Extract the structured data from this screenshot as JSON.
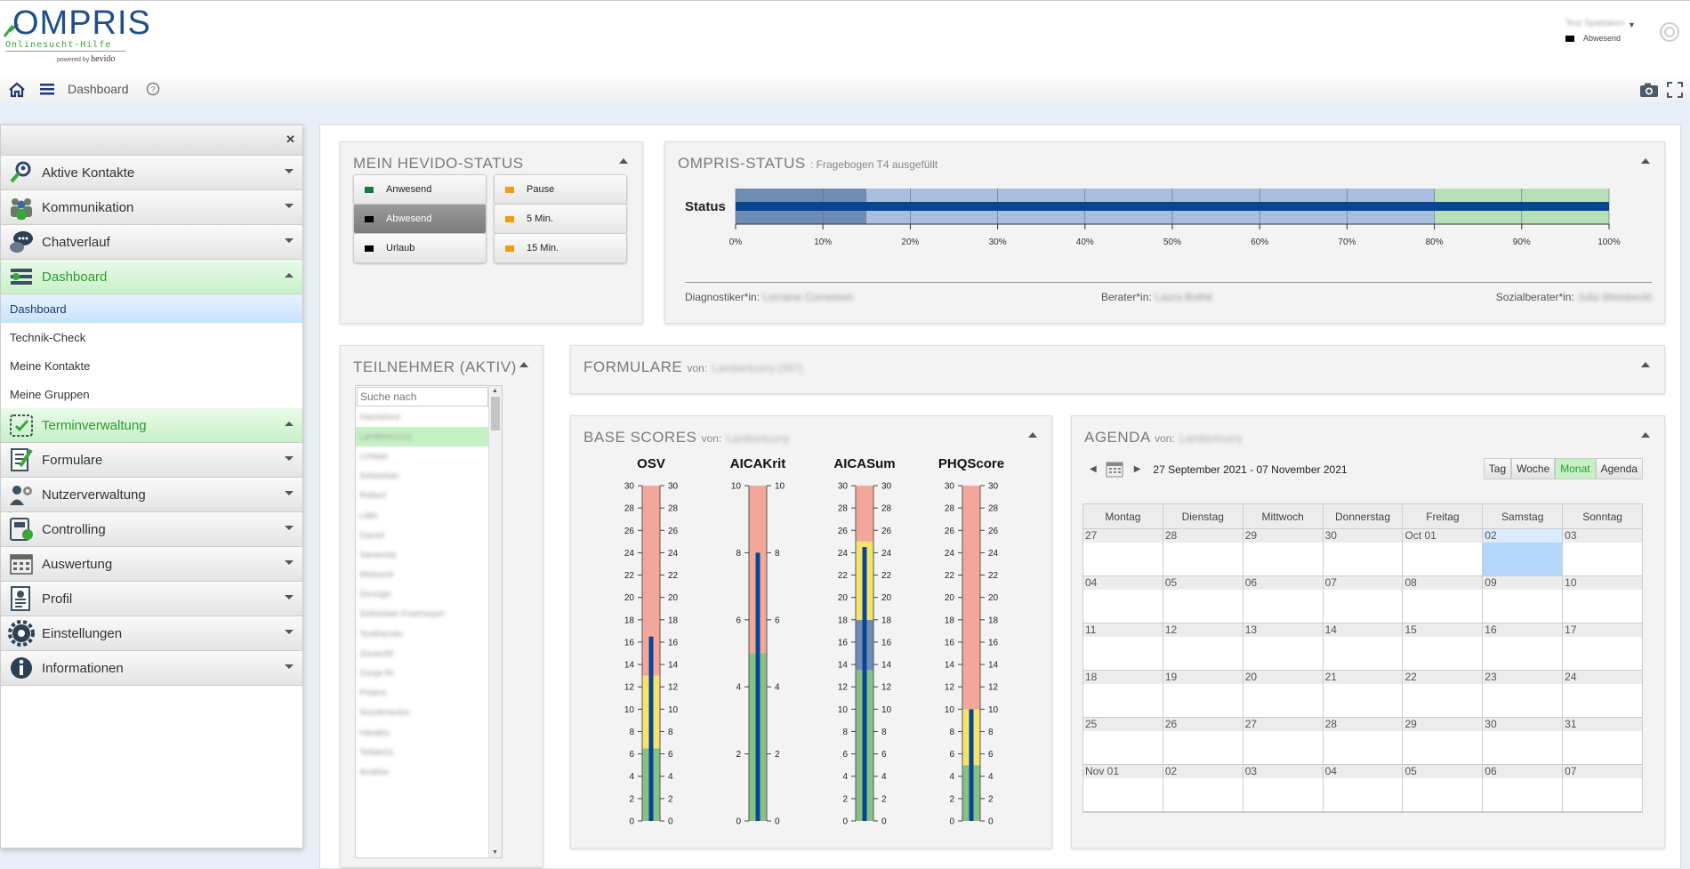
{
  "logo": {
    "main": "OMPRIS",
    "sub": "Onlinesucht-Hilfe",
    "powered": "powered by",
    "brand": "hevido"
  },
  "user": {
    "name": "Test Spattaken",
    "status": "Abwesend",
    "status_color": "#000000"
  },
  "nav": {
    "page": "Dashboard"
  },
  "sidebar": {
    "items": [
      {
        "label": "Aktive Kontakte",
        "icon": "search-person-icon"
      },
      {
        "label": "Kommunikation",
        "icon": "people-icon"
      },
      {
        "label": "Chatverlauf",
        "icon": "chat-icon"
      },
      {
        "label": "Dashboard",
        "icon": "dashboard-icon",
        "active": true
      },
      {
        "label": "Terminverwaltung",
        "icon": "calendar-check-icon",
        "active": true
      },
      {
        "label": "Formulare",
        "icon": "form-edit-icon"
      },
      {
        "label": "Nutzerverwaltung",
        "icon": "user-gear-icon"
      },
      {
        "label": "Controlling",
        "icon": "controlling-icon"
      },
      {
        "label": "Auswertung",
        "icon": "calendar-grid-icon"
      },
      {
        "label": "Profil",
        "icon": "profile-card-icon"
      },
      {
        "label": "Einstellungen",
        "icon": "gear-icon"
      },
      {
        "label": "Informationen",
        "icon": "info-icon"
      }
    ],
    "dashboard_sub": [
      "Dashboard",
      "Technik-Check",
      "Meine Kontakte",
      "Meine Gruppen"
    ]
  },
  "hevido_status": {
    "title": "MEIN HEVIDO-STATUS",
    "buttons": [
      {
        "label": "Anwesend",
        "color": "#1a7a3a"
      },
      {
        "label": "Pause",
        "color": "#f39c12"
      },
      {
        "label": "Abwesend",
        "color": "#000000",
        "selected": true
      },
      {
        "label": "5 Min.",
        "color": "#f39c12"
      },
      {
        "label": "Urlaub",
        "color": "#000000"
      },
      {
        "label": "15 Min.",
        "color": "#f39c12"
      }
    ]
  },
  "ompris_status": {
    "title": "OMPRIS-STATUS",
    "subtitle": ": Fragebogen T4 ausgefüllt",
    "row_label": "Status",
    "ticks": [
      "0%",
      "10%",
      "20%",
      "30%",
      "40%",
      "50%",
      "60%",
      "70%",
      "80%",
      "90%",
      "100%"
    ],
    "progress": 1.0,
    "bands": [
      {
        "from": 0,
        "to": 15,
        "color": "#6e8db5"
      },
      {
        "from": 15,
        "to": 80,
        "color": "#a9bfdf"
      },
      {
        "from": 80,
        "to": 100,
        "color": "#b7e0b7"
      }
    ],
    "diagnostiker_label": "Diagnostiker*in:",
    "diagnostiker": "Lorraine Corneisen",
    "berater_label": "Berater*in:",
    "berater": "Laura Bothé",
    "sozialberater_label": "Sozialberater*in:",
    "sozialberater": "Julia Weinbeckt"
  },
  "participants": {
    "title": "TEILNEHMER (AKTIV)",
    "search_placeholder": "Suche nach",
    "items": [
      "Hannelore",
      "Lambertcurry",
      "Lintaas",
      "Sebastian",
      "Robert",
      "Lilith",
      "Daniel",
      "Santeelia",
      "Weissnd",
      "Georgie",
      "Sebastian Kraemeyer",
      "Testfriendo",
      "Jonas48",
      "Sonja Rt",
      "Polaris",
      "Nussknacker",
      "Harakiu",
      "Tellalv01",
      "Analisa"
    ],
    "selected": 1
  },
  "formulare": {
    "title": "FORMULARE",
    "von": "von:",
    "who": "Lambertcurry (397)"
  },
  "base_scores": {
    "title": "BASE SCORES",
    "von": "von:",
    "who": "Lambertcurry"
  },
  "chart_data": [
    {
      "type": "bar",
      "title": "OSV",
      "ylim": [
        0,
        30
      ],
      "ticks": [
        0,
        2,
        4,
        6,
        8,
        10,
        12,
        14,
        16,
        18,
        20,
        22,
        24,
        26,
        28,
        30
      ],
      "value": 16.5,
      "bands": [
        {
          "from": 0,
          "to": 6.5,
          "color": "#86c286"
        },
        {
          "from": 6.5,
          "to": 13,
          "color": "#f5e46a"
        },
        {
          "from": 13,
          "to": 30,
          "color": "#f3a79a"
        }
      ]
    },
    {
      "type": "bar",
      "title": "AICAKrit",
      "ylim": [
        0,
        10
      ],
      "ticks": [
        0,
        2,
        4,
        6,
        8,
        10
      ],
      "value": 8,
      "bands": [
        {
          "from": 0,
          "to": 5,
          "color": "#86c286"
        },
        {
          "from": 5,
          "to": 10,
          "color": "#f3a79a"
        }
      ]
    },
    {
      "type": "bar",
      "title": "AICASum",
      "ylim": [
        0,
        30
      ],
      "ticks": [
        0,
        2,
        4,
        6,
        8,
        10,
        12,
        14,
        16,
        18,
        20,
        22,
        24,
        26,
        28,
        30
      ],
      "value": 24.5,
      "bands": [
        {
          "from": 0,
          "to": 13.5,
          "color": "#86c286"
        },
        {
          "from": 13.5,
          "to": 18,
          "color": "#6e8db5"
        },
        {
          "from": 18,
          "to": 25,
          "color": "#f5e46a"
        },
        {
          "from": 25,
          "to": 30,
          "color": "#f3a79a"
        }
      ]
    },
    {
      "type": "bar",
      "title": "PHQScore",
      "ylim": [
        0,
        30
      ],
      "ticks": [
        0,
        2,
        4,
        6,
        8,
        10,
        12,
        14,
        16,
        18,
        20,
        22,
        24,
        26,
        28,
        30
      ],
      "value": 10,
      "bands": [
        {
          "from": 0,
          "to": 5,
          "color": "#86c286"
        },
        {
          "from": 5,
          "to": 10,
          "color": "#f5e46a"
        },
        {
          "from": 10,
          "to": 30,
          "color": "#f3a79a"
        }
      ]
    }
  ],
  "agenda": {
    "title": "AGENDA",
    "von": "von:",
    "who": "Lambertcurry",
    "range": "27 September 2021 - 07 November 2021",
    "views": [
      "Tag",
      "Woche",
      "Monat",
      "Agenda"
    ],
    "active_view": "Monat",
    "weekdays": [
      "Montag",
      "Dienstag",
      "Mittwoch",
      "Donnerstag",
      "Freitag",
      "Samstag",
      "Sonntag"
    ],
    "weeks": [
      [
        "27",
        "28",
        "29",
        "30",
        "Oct 01",
        "02",
        "03"
      ],
      [
        "04",
        "05",
        "06",
        "07",
        "08",
        "09",
        "10"
      ],
      [
        "11",
        "12",
        "13",
        "14",
        "15",
        "16",
        "17"
      ],
      [
        "18",
        "19",
        "20",
        "21",
        "22",
        "23",
        "24"
      ],
      [
        "25",
        "26",
        "27",
        "28",
        "29",
        "30",
        "31"
      ],
      [
        "Nov 01",
        "02",
        "03",
        "04",
        "05",
        "06",
        "07"
      ]
    ],
    "today_cell": [
      0,
      5
    ],
    "today_color": "#b3d7fb"
  }
}
